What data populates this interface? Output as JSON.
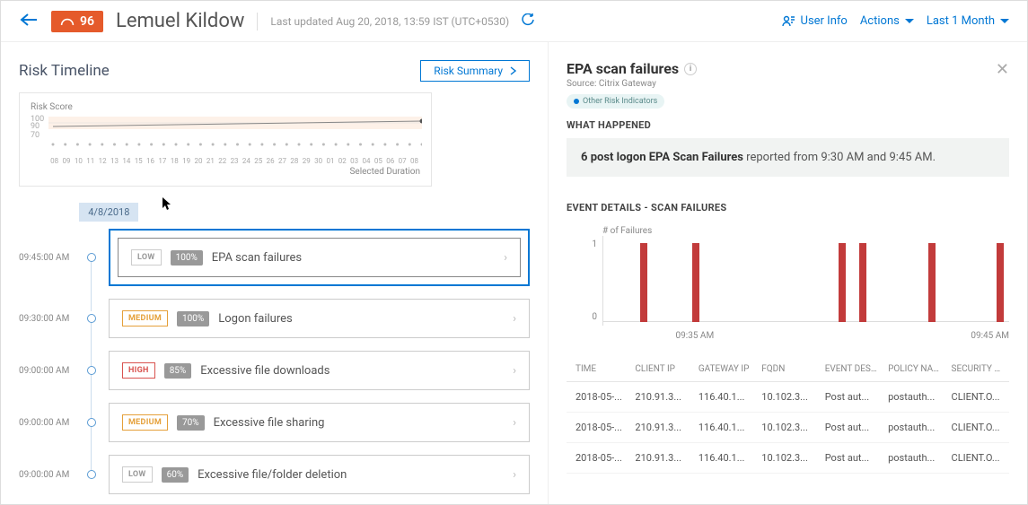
{
  "header": {
    "score": "96",
    "user_name": "Lemuel Kildow",
    "last_updated": "Last updated Aug 20, 2018, 13:59 IST (UTC+0530)",
    "user_info_label": "User Info",
    "actions_label": "Actions",
    "range_label": "Last 1 Month"
  },
  "timeline": {
    "title": "Risk Timeline",
    "summary_btn": "Risk Summary",
    "spark_label": "Risk Score",
    "spark_y": [
      "100",
      "90",
      "70"
    ],
    "spark_x": [
      "08",
      "09",
      "10",
      "11",
      "12",
      "13",
      "14",
      "15",
      "16",
      "17",
      "18",
      "19",
      "20",
      "21",
      "22",
      "23",
      "24",
      "25",
      "26",
      "27",
      "28",
      "29",
      "30",
      "01",
      "02",
      "03",
      "04",
      "05",
      "06",
      "07",
      "08"
    ],
    "spark_footer": "Selected Duration",
    "date_chip": "4/8/2018",
    "rows": [
      {
        "time": "09:45:00 AM",
        "sev": "LOW",
        "sev_class": "sev-low",
        "pct": "100%",
        "title": "EPA scan failures",
        "selected": true
      },
      {
        "time": "09:30:00 AM",
        "sev": "MEDIUM",
        "sev_class": "sev-medium",
        "pct": "100%",
        "title": "Logon failures",
        "selected": false
      },
      {
        "time": "09:00:00 AM",
        "sev": "HIGH",
        "sev_class": "sev-high",
        "pct": "85%",
        "title": "Excessive file downloads",
        "selected": false
      },
      {
        "time": "09:00:00 AM",
        "sev": "MEDIUM",
        "sev_class": "sev-medium",
        "pct": "70%",
        "title": "Excessive file sharing",
        "selected": false
      },
      {
        "time": "09:00:00 AM",
        "sev": "LOW",
        "sev_class": "sev-low",
        "pct": "60%",
        "title": "Excessive file/folder deletion",
        "selected": false
      }
    ]
  },
  "detail": {
    "title": "EPA scan failures",
    "source_label": "Source:",
    "source_value": "Citrix Gateway",
    "tag": "Other Risk Indicators",
    "what_happened_head": "WHAT HAPPENED",
    "what_happened_bold": "6 post logon EPA Scan Failures",
    "what_happened_rest": " reported from 9:30 AM and 9:45 AM.",
    "event_details_head": "EVENT DETAILS - SCAN FAILURES",
    "table_headers": [
      "TIME",
      "CLIENT IP",
      "GATEWAY IP",
      "FQDN",
      "EVENT DESCRI",
      "POLICY NAME",
      "SECURITY EXPR"
    ],
    "table_rows": [
      [
        "2018-05-...",
        "210.91.3...",
        "116.40.1...",
        "10.102.3...",
        "Post aut...",
        "postauth...",
        "CLIENT.O..."
      ],
      [
        "2018-05-...",
        "210.91.3...",
        "116.40.1...",
        "10.102.3...",
        "Post aut...",
        "postauth...",
        "CLIENT.O..."
      ],
      [
        "2018-05-...",
        "210.91.3...",
        "116.40.1...",
        "10.102.3...",
        "Post aut...",
        "postauth...",
        "CLIENT.O..."
      ]
    ]
  },
  "chart_data": {
    "type": "bar",
    "title": "# of Failures",
    "ylabel": "# of Failures",
    "ylim": [
      0,
      1
    ],
    "yticks": [
      "1",
      "0"
    ],
    "xticks": [
      "09:35 AM",
      "09:45 AM"
    ],
    "bars": [
      {
        "pos_pct": 9,
        "value": 1
      },
      {
        "pos_pct": 22,
        "value": 1
      },
      {
        "pos_pct": 58,
        "value": 1
      },
      {
        "pos_pct": 63,
        "value": 1
      },
      {
        "pos_pct": 80,
        "value": 1
      },
      {
        "pos_pct": 97,
        "value": 1
      }
    ]
  }
}
